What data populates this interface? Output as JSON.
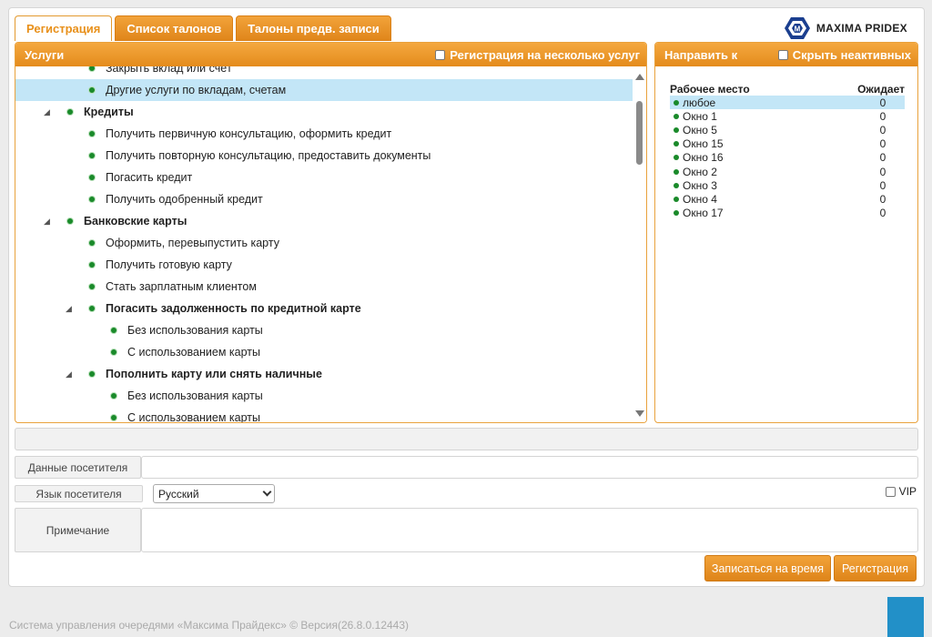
{
  "tabs": [
    {
      "label": "Регистрация",
      "active": true
    },
    {
      "label": "Список талонов",
      "active": false
    },
    {
      "label": "Талоны предв. записи",
      "active": false
    }
  ],
  "logo": {
    "text": "MAXIMA PRIDEX",
    "mark_letter": "M",
    "color": "#1b3f8f"
  },
  "services": {
    "title": "Услуги",
    "multi_label": "Регистрация на несколько услуг",
    "items": [
      {
        "label": "Закрыть вклад или счёт",
        "level": 2,
        "group": false,
        "expanded": false
      },
      {
        "label": "Другие услуги по вкладам, счетам",
        "level": 2,
        "group": false,
        "expanded": false,
        "selected": true
      },
      {
        "label": "Кредиты",
        "level": 1,
        "group": true,
        "expanded": true
      },
      {
        "label": "Получить первичную консультацию, оформить кредит",
        "level": 2,
        "group": false
      },
      {
        "label": "Получить повторную консультацию, предоставить документы",
        "level": 2,
        "group": false
      },
      {
        "label": "Погасить кредит",
        "level": 2,
        "group": false
      },
      {
        "label": "Получить одобренный кредит",
        "level": 2,
        "group": false
      },
      {
        "label": "Банковские карты",
        "level": 1,
        "group": true,
        "expanded": true
      },
      {
        "label": "Оформить, перевыпустить карту",
        "level": 2,
        "group": false
      },
      {
        "label": "Получить готовую карту",
        "level": 2,
        "group": false
      },
      {
        "label": "Стать зарплатным клиентом",
        "level": 2,
        "group": false
      },
      {
        "label": "Погасить задолженность по кредитной карте",
        "level": 2,
        "group": true,
        "expanded": true
      },
      {
        "label": "Без использования карты",
        "level": 3,
        "group": false
      },
      {
        "label": "С использованием карты",
        "level": 3,
        "group": false
      },
      {
        "label": "Пополнить карту или снять наличные",
        "level": 2,
        "group": true,
        "expanded": true
      },
      {
        "label": "Без использования карты",
        "level": 3,
        "group": false
      },
      {
        "label": "С использованием карты",
        "level": 3,
        "group": false
      }
    ]
  },
  "direct": {
    "title": "Направить к",
    "hide_inactive_label": "Скрыть неактивных",
    "col_workplace": "Рабочее место",
    "col_waiting": "Ожидает",
    "rows": [
      {
        "name": "любое",
        "waiting": "0",
        "selected": true
      },
      {
        "name": "Окно 1",
        "waiting": "0"
      },
      {
        "name": "Окно 5",
        "waiting": "0"
      },
      {
        "name": "Окно 15",
        "waiting": "0"
      },
      {
        "name": "Окно 16",
        "waiting": "0"
      },
      {
        "name": "Окно 2",
        "waiting": "0"
      },
      {
        "name": "Окно 3",
        "waiting": "0"
      },
      {
        "name": "Окно 4",
        "waiting": "0"
      },
      {
        "name": "Окно 17",
        "waiting": "0"
      }
    ]
  },
  "form": {
    "visitor_data_label": "Данные посетителя",
    "visitor_data_value": "",
    "language_label": "Язык посетителя",
    "language_value": "Русский",
    "vip_label": "VIP",
    "note_label": "Примечание",
    "note_value": ""
  },
  "buttons": {
    "book_time": "Записаться на время",
    "register": "Регистрация"
  },
  "footer": {
    "text": "Система управления очередями «Максима Прайдекс» © Версия(26.8.0.12443)"
  },
  "colors": {
    "accent": "#e8901a",
    "selection": "#c3e6f7",
    "status_dot": "#1a8a2a",
    "corner_button": "#2290c8"
  }
}
